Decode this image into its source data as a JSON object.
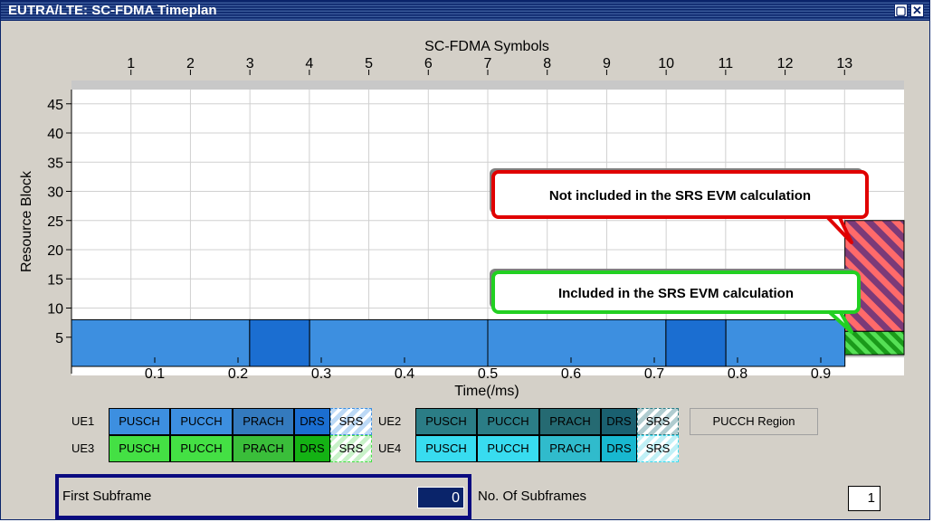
{
  "window": {
    "title": "EUTRA/LTE: SC-FDMA Timeplan"
  },
  "chart_data": {
    "type": "timeplan",
    "top_axis_label": "SC-FDMA Symbols",
    "top_ticks": [
      "1",
      "2",
      "3",
      "4",
      "5",
      "6",
      "7",
      "8",
      "9",
      "10",
      "11",
      "12",
      "13"
    ],
    "xlabel": "Time(/ms)",
    "x_ticks": [
      "0.1",
      "0.2",
      "0.3",
      "0.4",
      "0.5",
      "0.6",
      "0.7",
      "0.8",
      "0.9"
    ],
    "xlim": [
      0,
      1.0
    ],
    "ylabel": "Resource Block",
    "y_ticks": [
      "5",
      "10",
      "15",
      "20",
      "25",
      "30",
      "35",
      "40",
      "45"
    ],
    "ylim": [
      0,
      50
    ],
    "grid": true,
    "allocations": [
      {
        "name": "PUSCH",
        "x0": 0.0,
        "x1": 0.214,
        "rb0": 0,
        "rb1": 8,
        "color": "#3d8fe0"
      },
      {
        "name": "DRS",
        "x0": 0.214,
        "x1": 0.286,
        "rb0": 0,
        "rb1": 8,
        "color": "#1b6ed1"
      },
      {
        "name": "PUSCH",
        "x0": 0.286,
        "x1": 0.5,
        "rb0": 0,
        "rb1": 8,
        "color": "#3d8fe0"
      },
      {
        "name": "PUSCH",
        "x0": 0.5,
        "x1": 0.714,
        "rb0": 0,
        "rb1": 8,
        "color": "#3d8fe0"
      },
      {
        "name": "DRS",
        "x0": 0.714,
        "x1": 0.786,
        "rb0": 0,
        "rb1": 8,
        "color": "#1b6ed1"
      },
      {
        "name": "PUSCH",
        "x0": 0.786,
        "x1": 0.929,
        "rb0": 0,
        "rb1": 8,
        "color": "#3d8fe0"
      }
    ],
    "srs_blocks": [
      {
        "x0": 0.929,
        "x1": 1.0,
        "rb0": 6,
        "rb1": 25,
        "color_a": "#ff6a6a",
        "color_b": "#7b3a78"
      },
      {
        "x0": 0.929,
        "x1": 1.0,
        "rb0": 2,
        "rb1": 6,
        "color_a": "#55e055",
        "color_b": "#1a9a1a"
      }
    ],
    "callouts": [
      {
        "text": "Not included in the SRS EVM calculation",
        "color": "#e00000"
      },
      {
        "text": "Included in the SRS EVM calculation",
        "color": "#22d022"
      }
    ]
  },
  "legend": {
    "rows": [
      {
        "label": "UE1",
        "color_main": "#3d8fe0",
        "color_drs": "#1b6ed1",
        "color_srs": "#bcd9f6"
      },
      {
        "label": "UE2",
        "color_main": "#2b7d86",
        "color_drs": "#1a6070",
        "color_srs": "#b0ccd0"
      },
      {
        "label": "UE3",
        "color_main": "#44e044",
        "color_drs": "#14b214",
        "color_srs": "#c8f2c8"
      },
      {
        "label": "UE4",
        "color_main": "#38dcf0",
        "color_drs": "#18b8d0",
        "color_srs": "#c0f0f6"
      }
    ],
    "items": [
      "PUSCH",
      "PUCCH",
      "PRACH",
      "DRS",
      "SRS"
    ],
    "pucch_region": "PUCCH Region"
  },
  "controls": {
    "first_subframe_label": "First Subframe",
    "first_subframe_value": "0",
    "num_subframes_label": "No. Of Subframes",
    "num_subframes_value": "1"
  }
}
